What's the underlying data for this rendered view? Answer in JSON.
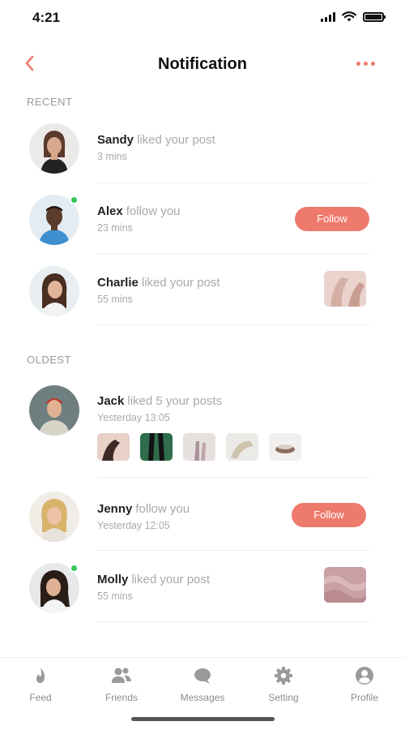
{
  "status_bar": {
    "time": "4:21"
  },
  "header": {
    "title": "Notification"
  },
  "colors": {
    "accent": "#ee7a6c",
    "online": "#33c759",
    "muted": "#a9a9a9"
  },
  "sections": {
    "recent_label": "RECENT",
    "oldest_label": "OLDEST"
  },
  "notifications": [
    {
      "name": "Sandy",
      "action": "liked your post",
      "time": "3 mins"
    },
    {
      "name": "Alex",
      "action": "follow you",
      "time": "23 mins",
      "button": "Follow"
    },
    {
      "name": "Charlie",
      "action": "liked your post",
      "time": "55 mins"
    },
    {
      "name": "Jack",
      "action": "liked 5 your posts",
      "time": "Yesterday 13:05"
    },
    {
      "name": "Jenny",
      "action": "follow you",
      "time": "Yesterday 12:05",
      "button": "Follow"
    },
    {
      "name": "Molly",
      "action": "liked your post",
      "time": "55 mins"
    }
  ],
  "tabbar": {
    "items": [
      {
        "label": "Feed",
        "icon": "flame-icon"
      },
      {
        "label": "Friends",
        "icon": "friends-icon"
      },
      {
        "label": "Messages",
        "icon": "chat-bubble-icon"
      },
      {
        "label": "Setting",
        "icon": "gear-icon"
      },
      {
        "label": "Profile",
        "icon": "profile-icon"
      }
    ]
  }
}
